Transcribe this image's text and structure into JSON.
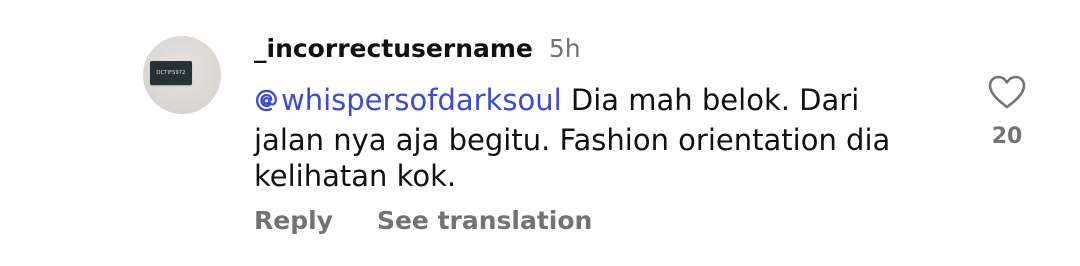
{
  "comment": {
    "avatar": {
      "logo_text": "OCTIFS972"
    },
    "username": "_incorrectusername",
    "timestamp": "5h",
    "mention": "whispersofdarksoul",
    "text_line1": " Dia mah belok. Dari",
    "text_line2": "jalan nya aja begitu. Fashion orientation dia",
    "text_line3": "kelihatan kok.",
    "actions": {
      "reply_label": "Reply",
      "translate_label": "See translation"
    },
    "likes": {
      "count": "20",
      "icon": "heart-outline-icon"
    },
    "mention_icon": "threads-at-icon",
    "colors": {
      "mention": "#3c4bcf",
      "secondary_text": "#737373",
      "primary_text": "#111111"
    }
  }
}
